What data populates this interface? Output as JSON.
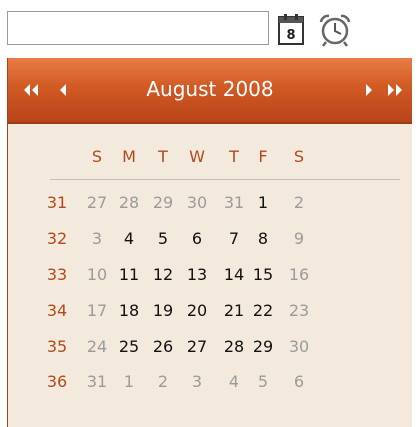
{
  "input": {
    "value": "",
    "placeholder": ""
  },
  "calendar": {
    "title": "August 2008",
    "weekdays": [
      "S",
      "M",
      "T",
      "W",
      "T",
      "F",
      "S"
    ],
    "weeks": [
      {
        "week": "31",
        "days": [
          "27",
          "28",
          "29",
          "30",
          "31",
          "1",
          "2"
        ]
      },
      {
        "week": "32",
        "days": [
          "3",
          "4",
          "5",
          "6",
          "7",
          "8",
          "9"
        ]
      },
      {
        "week": "33",
        "days": [
          "10",
          "11",
          "12",
          "13",
          "14",
          "15",
          "16"
        ]
      },
      {
        "week": "34",
        "days": [
          "17",
          "18",
          "19",
          "20",
          "21",
          "22",
          "23"
        ]
      },
      {
        "week": "35",
        "days": [
          "24",
          "25",
          "26",
          "27",
          "28",
          "29",
          "30"
        ]
      },
      {
        "week": "36",
        "days": [
          "31",
          "1",
          "2",
          "3",
          "4",
          "5",
          "6"
        ]
      }
    ]
  },
  "icons": {
    "calendar": "calendar-icon",
    "clock": "alarm-clock-icon",
    "prev_year": "double-left-arrow-icon",
    "prev_month": "left-arrow-icon",
    "next_month": "right-arrow-icon",
    "next_year": "double-right-arrow-icon"
  },
  "colors": {
    "header": "#d15a24",
    "accent_text": "#b34a1c",
    "background": "#f3eadd",
    "muted_text": "#9b9b9b",
    "day_text": "#111111"
  }
}
